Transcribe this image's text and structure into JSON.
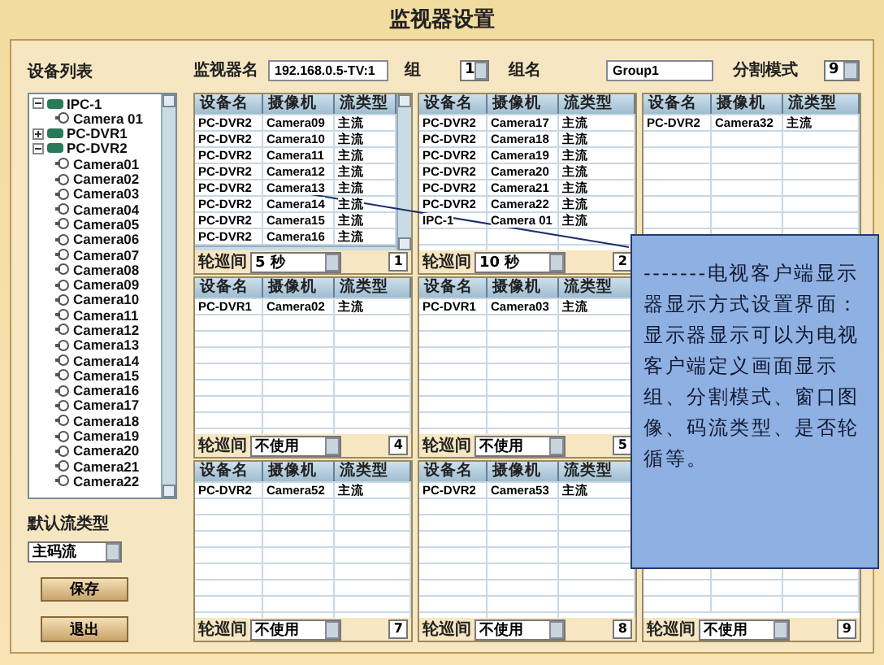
{
  "window": {
    "title": "监视器设置"
  },
  "sidebar": {
    "title": "设备列表",
    "tree": [
      {
        "label": "IPC-1",
        "kind": "device",
        "expanded": true,
        "children": [
          {
            "label": "Camera 01",
            "kind": "camera"
          }
        ]
      },
      {
        "label": "PC-DVR1",
        "kind": "device",
        "expanded": false
      },
      {
        "label": "PC-DVR2",
        "kind": "device",
        "expanded": true,
        "children": [
          {
            "label": "Camera01",
            "kind": "camera"
          },
          {
            "label": "Camera02",
            "kind": "camera"
          },
          {
            "label": "Camera03",
            "kind": "camera"
          },
          {
            "label": "Camera04",
            "kind": "camera"
          },
          {
            "label": "Camera05",
            "kind": "camera"
          },
          {
            "label": "Camera06",
            "kind": "camera"
          },
          {
            "label": "Camera07",
            "kind": "camera"
          },
          {
            "label": "Camera08",
            "kind": "camera"
          },
          {
            "label": "Camera09",
            "kind": "camera"
          },
          {
            "label": "Camera10",
            "kind": "camera"
          },
          {
            "label": "Camera11",
            "kind": "camera"
          },
          {
            "label": "Camera12",
            "kind": "camera"
          },
          {
            "label": "Camera13",
            "kind": "camera"
          },
          {
            "label": "Camera14",
            "kind": "camera"
          },
          {
            "label": "Camera15",
            "kind": "camera"
          },
          {
            "label": "Camera16",
            "kind": "camera"
          },
          {
            "label": "Camera17",
            "kind": "camera"
          },
          {
            "label": "Camera18",
            "kind": "camera"
          },
          {
            "label": "Camera19",
            "kind": "camera"
          },
          {
            "label": "Camera20",
            "kind": "camera"
          },
          {
            "label": "Camera21",
            "kind": "camera"
          },
          {
            "label": "Camera22",
            "kind": "camera"
          }
        ]
      }
    ],
    "stream_label": "默认流类型",
    "stream_value": "主码流",
    "buttons": [
      "保存",
      "退出"
    ]
  },
  "toolbar": {
    "monitor_label": "监视器名",
    "monitor_value": "192.168.0.5-TV:1",
    "group_label": "组",
    "group_value": "1",
    "group_name_label": "组名",
    "group_name_value": "Group1",
    "split_label": "分割模式",
    "split_value": "9"
  },
  "panels": [
    {
      "columns": [
        "设备名",
        "摄像机",
        "流类型"
      ],
      "scroll": true,
      "rows": [
        [
          "PC-DVR2",
          "Camera09",
          "主流"
        ],
        [
          "PC-DVR2",
          "Camera10",
          "主流"
        ],
        [
          "PC-DVR2",
          "Camera11",
          "主流"
        ],
        [
          "PC-DVR2",
          "Camera12",
          "主流"
        ],
        [
          "PC-DVR2",
          "Camera13",
          "主流"
        ],
        [
          "PC-DVR2",
          "Camera14",
          "主流"
        ],
        [
          "PC-DVR2",
          "Camera15",
          "主流"
        ],
        [
          "PC-DVR2",
          "Camera16",
          "主流"
        ]
      ],
      "footer": {
        "label": "轮巡间",
        "interval": "5 秒",
        "number": "1"
      }
    },
    {
      "columns": [
        "设备名",
        "摄像机",
        "流类型"
      ],
      "scroll": false,
      "rows": [
        [
          "PC-DVR2",
          "Camera17",
          "主流"
        ],
        [
          "PC-DVR2",
          "Camera18",
          "主流"
        ],
        [
          "PC-DVR2",
          "Camera19",
          "主流"
        ],
        [
          "PC-DVR2",
          "Camera20",
          "主流"
        ],
        [
          "PC-DVR2",
          "Camera21",
          "主流"
        ],
        [
          "PC-DVR2",
          "Camera22",
          "主流"
        ],
        [
          "IPC-1",
          "Camera 01",
          "主流"
        ]
      ],
      "footer": {
        "label": "轮巡间",
        "interval": "10 秒",
        "number": "2"
      }
    },
    {
      "columns": [
        "设备名",
        "摄像机",
        "流类型"
      ],
      "scroll": false,
      "rows": [
        [
          "PC-DVR2",
          "Camera32",
          "主流"
        ]
      ]
    },
    {
      "columns": [
        "设备名",
        "摄像机",
        "流类型"
      ],
      "scroll": false,
      "rows": [
        [
          "PC-DVR1",
          "Camera02",
          "主流"
        ]
      ],
      "footer": {
        "label": "轮巡间",
        "interval": "不使用",
        "number": "4"
      }
    },
    {
      "columns": [
        "设备名",
        "摄像机",
        "流类型"
      ],
      "scroll": false,
      "rows": [
        [
          "PC-DVR1",
          "Camera03",
          "主流"
        ]
      ],
      "footer": {
        "label": "轮巡间",
        "interval": "不使用",
        "number": "5"
      }
    },
    {
      "columns": [
        "设备名",
        "摄像机",
        "流类型"
      ],
      "scroll": false,
      "rows": [
        [
          "PC-DVR2",
          "Camera52",
          "主流"
        ]
      ],
      "footer": {
        "label": "轮巡间",
        "interval": "不使用",
        "number": "7"
      }
    },
    {
      "columns": [
        "设备名",
        "摄像机",
        "流类型"
      ],
      "scroll": false,
      "rows": [
        [
          "PC-DVR2",
          "Camera53",
          "主流"
        ]
      ],
      "footer": {
        "label": "轮巡间",
        "interval": "不使用",
        "number": "8"
      }
    },
    {
      "scroll": false,
      "footer": {
        "label": "轮巡间",
        "interval": "不使用",
        "number": "9"
      }
    }
  ],
  "callout": {
    "text": "-------电视客户端显示器显示方式设置界面：显示器显示可以为电视客户端定义画面显示组、分割模式、窗口图像、码流类型、是否轮循等。"
  }
}
